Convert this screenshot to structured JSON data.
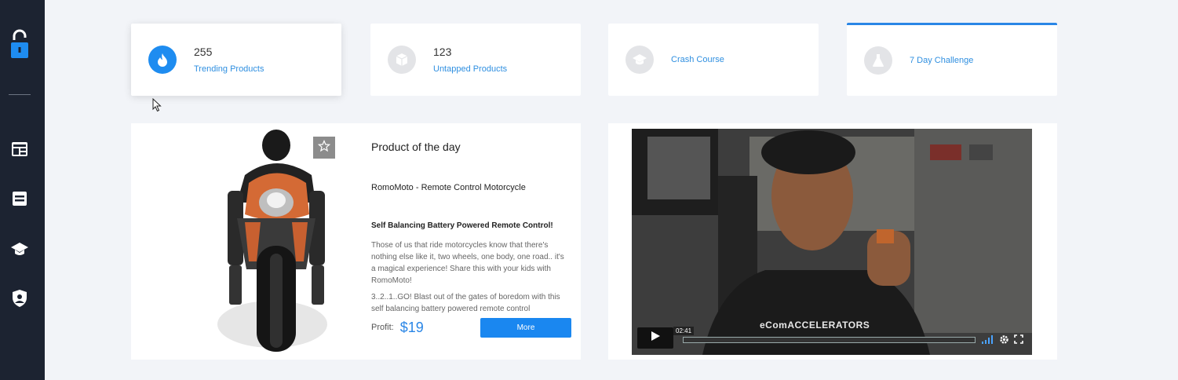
{
  "sidebar": {
    "items": [
      {
        "icon": "unlock-icon"
      },
      {
        "icon": "dashboard-icon"
      },
      {
        "icon": "list-icon"
      },
      {
        "icon": "graduation-cap-icon"
      },
      {
        "icon": "user-shield-icon"
      }
    ]
  },
  "stats": [
    {
      "number": "255",
      "label": "Trending Products",
      "icon": "fire-icon"
    },
    {
      "number": "123",
      "label": "Untapped Products",
      "icon": "box-icon"
    },
    {
      "number": "",
      "label": "Crash Course",
      "icon": "graduation-cap-icon"
    },
    {
      "number": "",
      "label": "7 Day Challenge",
      "icon": "flask-icon"
    }
  ],
  "product": {
    "section_title": "Product of the day",
    "name": "RomoMoto - Remote Control Motorcycle",
    "subtitle": "Self Balancing Battery Powered Remote Control!",
    "desc_1": "Those of us that ride motorcycles know that there's nothing else like it, two wheels, one body, one road.. it's a magical experience! Share this with your kids with RomoMoto!",
    "desc_2": "3..2..1..GO! Blast out of the gates of boredom with this self balancing battery powered remote control",
    "profit_label": "Profit:",
    "profit_value": "$19",
    "more_label": "More"
  },
  "video": {
    "time": "02:41",
    "shirt_text": "eComACCELERATORS"
  },
  "colors": {
    "accent": "#1a87f0",
    "sidebar_bg": "#1c2331",
    "link": "#2f8fe0"
  }
}
